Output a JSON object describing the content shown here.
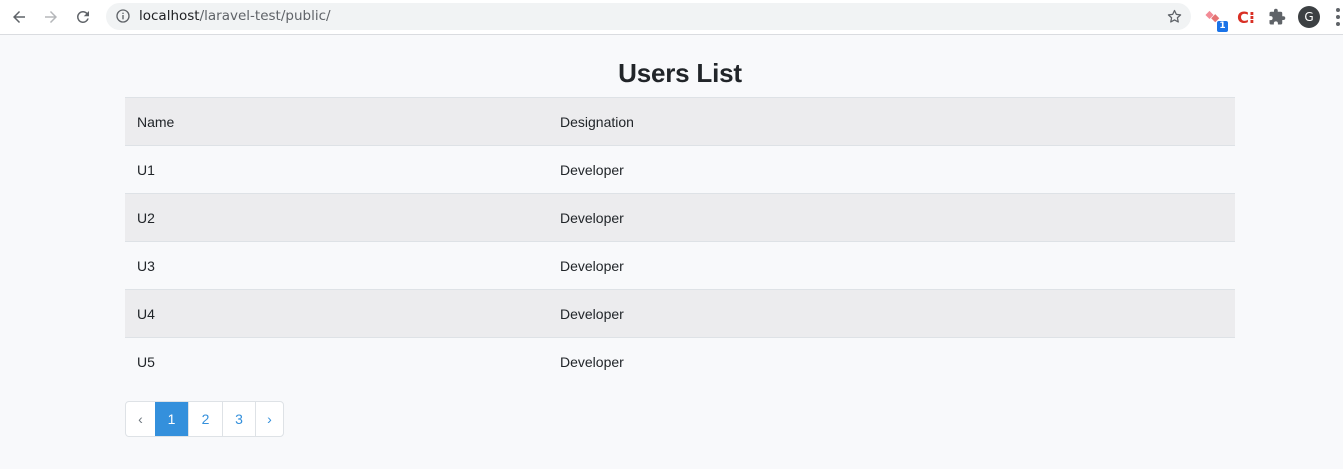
{
  "browser": {
    "url_host": "localhost",
    "url_path": "/laravel-test/public/",
    "profile_initial": "G",
    "extension_badge": "1",
    "extension2_label": "C⁝"
  },
  "page": {
    "title": "Users List"
  },
  "table": {
    "headers": [
      "Name",
      "Designation"
    ],
    "rows": [
      {
        "name": "U1",
        "designation": "Developer"
      },
      {
        "name": "U2",
        "designation": "Developer"
      },
      {
        "name": "U3",
        "designation": "Developer"
      },
      {
        "name": "U4",
        "designation": "Developer"
      },
      {
        "name": "U5",
        "designation": "Developer"
      }
    ]
  },
  "pagination": {
    "prev": "‹",
    "pages": [
      "1",
      "2",
      "3"
    ],
    "active_page": "1",
    "next": "›"
  },
  "colors": {
    "accent": "#3490dc",
    "row_striped": "#ececee",
    "page_bg": "#f8f9fb"
  }
}
